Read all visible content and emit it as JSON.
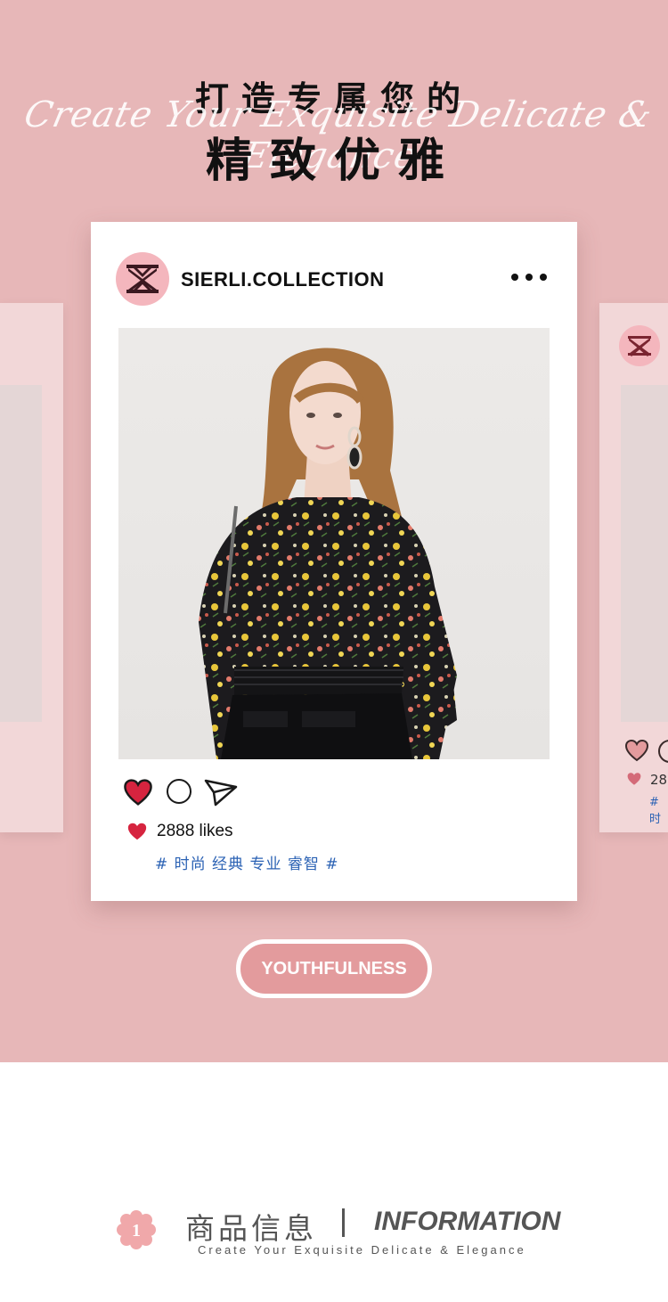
{
  "header": {
    "title_line1": "打造专属您的",
    "script_text": "Create Your Exquisite Delicate & Elegance",
    "title_line2": "精致优雅"
  },
  "post": {
    "account_name": "SIERLI.COLLECTION",
    "likes": "2888 likes",
    "hashtags": "# 时尚 经典 专业 睿智 #"
  },
  "side_card_right": {
    "likes_partial": "28",
    "hashtag_partial": "# 时"
  },
  "pill_label": "YOUTHFULNESS",
  "info": {
    "badge_number": "1",
    "title_cn": "商品信息",
    "title_en": "INFORMATION",
    "subtitle": "Create Your Exquisite Delicate & Elegance"
  },
  "colors": {
    "page_pink": "#e7b7b8",
    "avatar_pink": "#f4b6bd",
    "heart_red": "#d6243f",
    "hashtag_blue": "#2b62b4",
    "pill_fill": "#e39b9d"
  },
  "icons": [
    "heart-icon",
    "comment-icon",
    "share-icon",
    "more-icon",
    "brand-logo",
    "flower-badge-icon"
  ]
}
